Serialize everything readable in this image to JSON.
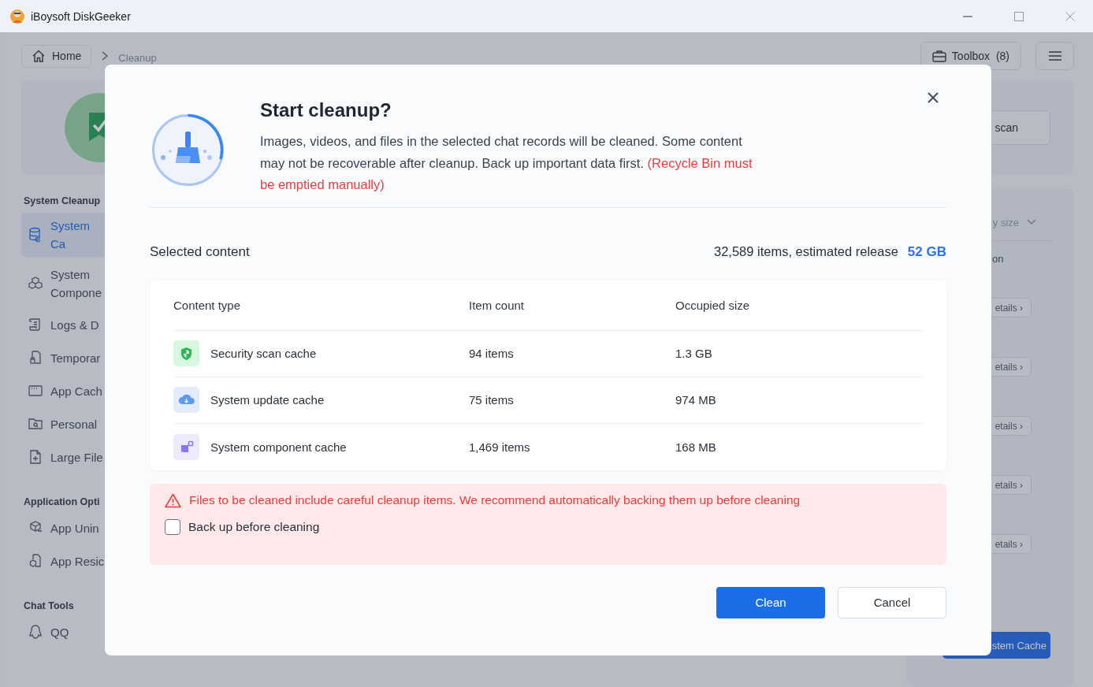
{
  "window": {
    "title": "iBoysoft DiskGeeker"
  },
  "breadcrumb": {
    "home": "Home",
    "current": "Cleanup"
  },
  "toolbox": {
    "label": "Toolbox",
    "count": "(8)"
  },
  "sidebar": {
    "sections": [
      {
        "title": "System Cleanup",
        "items": [
          {
            "label": "System Ca",
            "selected": true
          },
          {
            "label": "System Compone",
            "selected": false
          },
          {
            "label": "Logs & D",
            "selected": false
          },
          {
            "label": "Temporar",
            "selected": false
          },
          {
            "label": "App Cach",
            "selected": false
          },
          {
            "label": "Personal",
            "selected": false
          },
          {
            "label": "Large File",
            "selected": false
          }
        ]
      },
      {
        "title": "Application Opti",
        "items": [
          {
            "label": "App Unin",
            "selected": false
          },
          {
            "label": "App Resic",
            "selected": false
          }
        ]
      },
      {
        "title": "Chat Tools",
        "items": [
          {
            "label": "QQ",
            "selected": false
          }
        ]
      }
    ]
  },
  "background_right": {
    "scan_button": "scan",
    "sort": "y size",
    "column_label": "on",
    "details_buttons": [
      "etails ›",
      "etails ›",
      "etails ›",
      "etails ›",
      "etails ›"
    ],
    "action_button": "stem Cache"
  },
  "dialog": {
    "title": "Start cleanup?",
    "message": "Images, videos, and files in the selected chat records will be cleaned. Some content may not be recoverable after cleanup. Back up important data first.",
    "note": "(Recycle Bin must be emptied manually)",
    "selected_label": "Selected content",
    "summary": "32,589 items, estimated release",
    "release_size": "52 GB",
    "table": {
      "columns": [
        "Content type",
        "Item count",
        "Occupied size"
      ],
      "rows": [
        {
          "kind": "security",
          "name": "Security scan cache",
          "count": "94 items",
          "size": "1.3 GB"
        },
        {
          "kind": "update",
          "name": "System update cache",
          "count": "75 items",
          "size": "974 MB"
        },
        {
          "kind": "component",
          "name": "System component cache",
          "count": "1,469 items",
          "size": "168 MB"
        }
      ]
    },
    "warning": "Files to be cleaned include careful cleanup items. We recommend automatically backing them up before cleaning",
    "backup": {
      "label": "Back up before cleaning",
      "checked": false
    },
    "buttons": [
      {
        "label": "Clean",
        "kind": "primary"
      },
      {
        "label": "Cancel",
        "kind": "secondary"
      }
    ]
  }
}
